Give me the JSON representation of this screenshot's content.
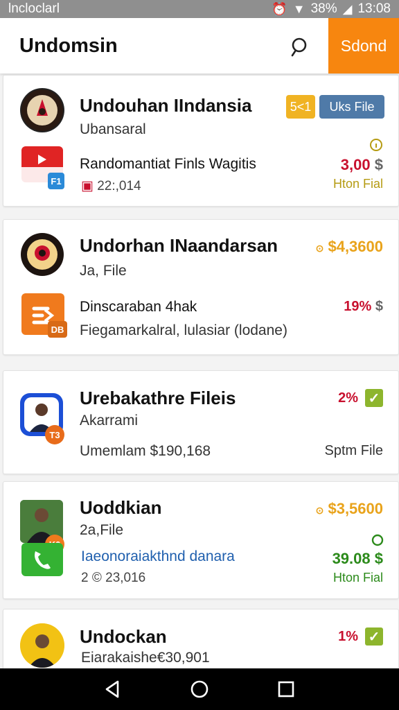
{
  "status_bar": {
    "carrier": "lncloclarl",
    "battery": "38%",
    "time": "13:08"
  },
  "app_bar": {
    "title": "Undomsin",
    "action_label": "Sdond"
  },
  "cards": [
    {
      "title": "Undouhan IIndansia",
      "subtitle": "Ubansaral",
      "badge_1": "5<1",
      "badge_2": "Uks File",
      "line": "Randomantiat Finls Wagitis",
      "meta": "22:,014",
      "tile_badge": "F1",
      "value": "3,00",
      "value_note": "Hton Fial"
    },
    {
      "title": "Undorhan INaandarsan",
      "subtitle": "Ja, File",
      "line": "Dinscaraban 4hak",
      "meta": "Fiegamarkalral, lulasiar (lodane)",
      "tile_badge": "DB",
      "value_top": "$4,3600",
      "value": "19%"
    },
    {
      "title": "Urebakathre Fileis",
      "subtitle": "Akarrami",
      "line": "Umemlam $190,168",
      "value": "2%",
      "value_note": "Sptm File",
      "avatar_badge": "T3"
    },
    {
      "title": "Uoddkian",
      "subtitle": "2a,File",
      "line": "Iaeonoraiakthnd danara",
      "meta": "2 © 23,016",
      "value_top": "$3,5600",
      "value": "39.08",
      "value_note": "Hton Fial",
      "avatar_badge": "K0"
    },
    {
      "title": "Undockan",
      "line": "Eiarakaishe€30,901",
      "value": "1%"
    }
  ],
  "colors": {
    "accent": "#f7860f",
    "status_bar": "#8f8f8f",
    "red": "#c8102e",
    "green": "#2b8a1a",
    "gold": "#e9a31b"
  }
}
